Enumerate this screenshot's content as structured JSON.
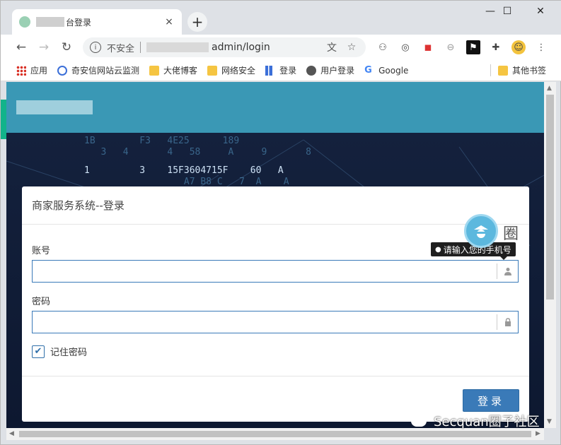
{
  "browser": {
    "tab_title": "台登录",
    "tab_close": "×",
    "newtab": "+",
    "window_controls": [
      "—",
      "☐",
      "✕"
    ],
    "address": {
      "insecure_label": "不安全",
      "url": "admin/login"
    },
    "bookmarks": [
      {
        "label": "应用",
        "icon": "apps-icon"
      },
      {
        "label": "奇安信网站云监测",
        "icon": "qianxin-icon"
      },
      {
        "label": "大佬博客",
        "icon": "folder-icon"
      },
      {
        "label": "网络安全",
        "icon": "folder-icon"
      },
      {
        "label": "登录",
        "icon": "bars-icon"
      },
      {
        "label": "用户登录",
        "icon": "globe-icon"
      },
      {
        "label": "Google",
        "icon": "google-icon"
      },
      {
        "label": "其他书签",
        "icon": "folder-icon"
      }
    ]
  },
  "modal": {
    "title": "商家服务系统--登录",
    "account_label": "账号",
    "account_placeholder": "",
    "password_label": "密码",
    "password_placeholder": "",
    "remember_label": "记住密码",
    "remember_checked": true,
    "login_button": "登录"
  },
  "tooltip": {
    "text": "请输入您的手机号"
  },
  "watermark": {
    "text": "Secquan圈子社区",
    "badge_char": "圈"
  },
  "matrix": {
    "lines": [
      "1B        F3   4E25      189",
      "   3   4       4   58     A     9       8",
      "1         3    15F3604715F    60   A",
      "                  A7 B8 C   7  A    A"
    ]
  },
  "colors": {
    "header": "#3a98b5",
    "accent": "#3a7ab8",
    "background": "#0e1a33"
  }
}
